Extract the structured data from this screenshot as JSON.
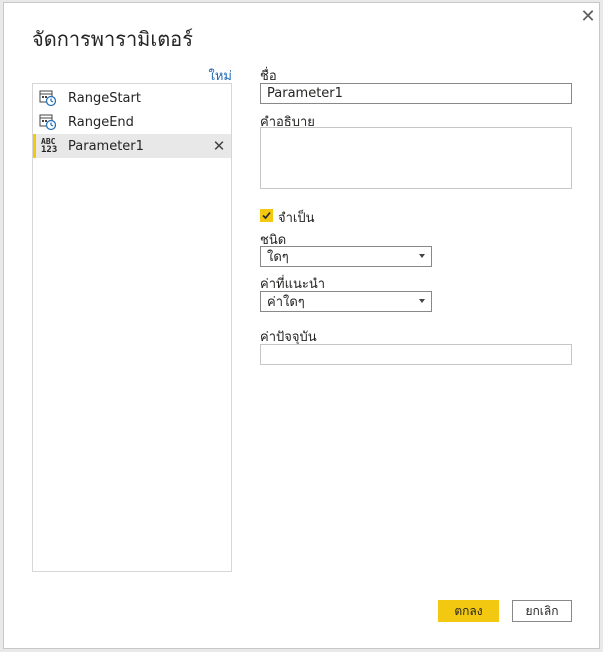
{
  "dialog": {
    "title": "จัดการพารามิเตอร์",
    "close_glyph": "✕"
  },
  "list": {
    "new_label": "ใหม่",
    "items": [
      {
        "label": "RangeStart",
        "icon": "calendar-clock-icon",
        "selected": false
      },
      {
        "label": "RangeEnd",
        "icon": "calendar-clock-icon",
        "selected": false
      },
      {
        "label": "Parameter1",
        "icon": "abc-123-icon",
        "icon_text_top": "ABC",
        "icon_text_bottom": "123",
        "selected": true
      }
    ],
    "remove_glyph": "✕"
  },
  "form": {
    "name_label": "ชื่อ",
    "name_value": "Parameter1",
    "description_label": "คำอธิบาย",
    "description_value": "",
    "required_label": "จำเป็น",
    "required_checked": true,
    "type_label": "ชนิด",
    "type_value": "ใดๆ",
    "suggested_label": "ค่าที่แนะนำ",
    "suggested_value": "ค่าใดๆ",
    "current_label": "ค่าปัจจุบัน",
    "current_value": ""
  },
  "buttons": {
    "ok_label": "ตกลง",
    "cancel_label": "ยกเลิก"
  },
  "colors": {
    "accent": "#f2c811",
    "link": "#1f6bb5",
    "selected_bg": "#e8e8e8"
  }
}
